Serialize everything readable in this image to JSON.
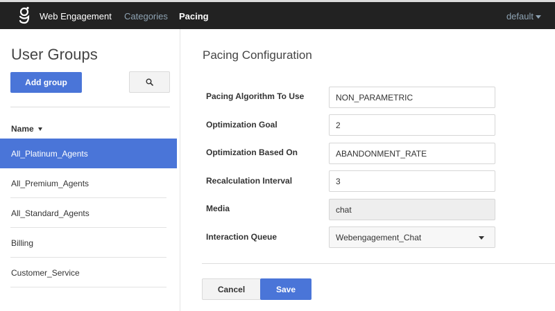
{
  "topbar": {
    "logo_icon": "genesys-logo-icon",
    "brand": "Web Engagement",
    "nav": [
      {
        "label": "Categories",
        "active": false
      },
      {
        "label": "Pacing",
        "active": true
      }
    ],
    "user_menu": "default"
  },
  "sidebar": {
    "title": "User Groups",
    "add_group_label": "Add group",
    "search_icon": "search-icon",
    "column_header": "Name",
    "groups": [
      {
        "label": "All_Platinum_Agents",
        "selected": true
      },
      {
        "label": "All_Premium_Agents",
        "selected": false
      },
      {
        "label": "All_Standard_Agents",
        "selected": false
      },
      {
        "label": "Billing",
        "selected": false
      },
      {
        "label": "Customer_Service",
        "selected": false
      }
    ]
  },
  "main": {
    "title": "Pacing Configuration",
    "fields": [
      {
        "label": "Pacing Algorithm To Use",
        "value": "NON_PARAMETRIC",
        "type": "text"
      },
      {
        "label": "Optimization Goal",
        "value": "2",
        "type": "text"
      },
      {
        "label": "Optimization Based On",
        "value": "ABANDONMENT_RATE",
        "type": "text"
      },
      {
        "label": "Recalculation Interval",
        "value": "3",
        "type": "text"
      },
      {
        "label": "Media",
        "value": "chat",
        "type": "disabled"
      },
      {
        "label": "Interaction Queue",
        "value": "Webengagement_Chat",
        "type": "select"
      }
    ],
    "cancel_label": "Cancel",
    "save_label": "Save"
  },
  "colors": {
    "accent": "#4a75d8",
    "topbar": "#222222",
    "nav_inactive": "#8ea3b3"
  }
}
